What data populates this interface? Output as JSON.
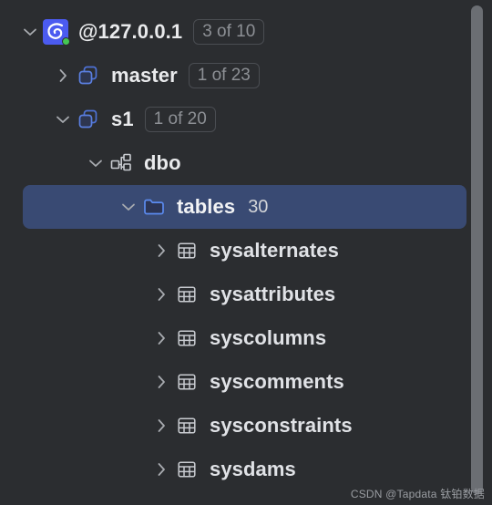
{
  "window": {
    "background_color": "#2b2d30",
    "selection_color": "#394a73",
    "accent_color": "#4b5bf0"
  },
  "tree": {
    "nodes": [
      {
        "id": "server",
        "label": "@127.0.0.1",
        "badge": "3 of 10",
        "icon": "database-server-icon",
        "twisty": "chevron-down-icon",
        "expanded": true,
        "depth": 0,
        "selected": false,
        "status": "connected"
      },
      {
        "id": "master",
        "label": "master",
        "badge": "1 of 23",
        "icon": "database-icon",
        "twisty": "chevron-right-icon",
        "expanded": false,
        "depth": 1,
        "selected": false
      },
      {
        "id": "s1",
        "label": "s1",
        "badge": "1 of 20",
        "icon": "database-icon",
        "twisty": "chevron-down-icon",
        "expanded": true,
        "depth": 1,
        "selected": false
      },
      {
        "id": "dbo",
        "label": "dbo",
        "badge": "",
        "icon": "schema-icon",
        "twisty": "chevron-down-icon",
        "expanded": true,
        "depth": 2,
        "selected": false
      },
      {
        "id": "tables",
        "label": "tables",
        "badge": "30",
        "icon": "folder-icon",
        "twisty": "chevron-down-icon",
        "expanded": true,
        "depth": 3,
        "selected": true
      },
      {
        "id": "sysalternates",
        "label": "sysalternates",
        "badge": "",
        "icon": "table-icon",
        "twisty": "chevron-right-icon",
        "expanded": false,
        "depth": 4,
        "selected": false
      },
      {
        "id": "sysattributes",
        "label": "sysattributes",
        "badge": "",
        "icon": "table-icon",
        "twisty": "chevron-right-icon",
        "expanded": false,
        "depth": 4,
        "selected": false
      },
      {
        "id": "syscolumns",
        "label": "syscolumns",
        "badge": "",
        "icon": "table-icon",
        "twisty": "chevron-right-icon",
        "expanded": false,
        "depth": 4,
        "selected": false
      },
      {
        "id": "syscomments",
        "label": "syscomments",
        "badge": "",
        "icon": "table-icon",
        "twisty": "chevron-right-icon",
        "expanded": false,
        "depth": 4,
        "selected": false
      },
      {
        "id": "sysconstraints",
        "label": "sysconstraints",
        "badge": "",
        "icon": "table-icon",
        "twisty": "chevron-right-icon",
        "expanded": false,
        "depth": 4,
        "selected": false
      },
      {
        "id": "sysdams",
        "label": "sysdams",
        "badge": "",
        "icon": "table-icon",
        "twisty": "chevron-right-icon",
        "expanded": false,
        "depth": 4,
        "selected": false
      }
    ]
  },
  "scrollbar": {
    "name": "vertical-scrollbar",
    "thumb_color": "#6b6e73"
  },
  "watermark": {
    "text": "CSDN @Tapdata 钛铂数据"
  }
}
